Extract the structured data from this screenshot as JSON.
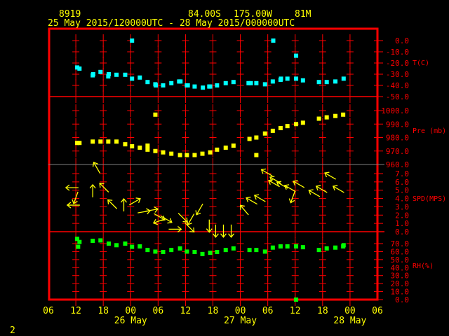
{
  "header": {
    "station": "8919",
    "latitude": "84.00S",
    "longitude": "175.00W",
    "elevation": "81M",
    "period": "25 May 2015/120000UTC - 28 May 2015/000000UTC"
  },
  "footer": {
    "page": "2"
  },
  "colors": {
    "frame": "#ff0000",
    "text": "#ffff00",
    "temperature": "#00ffff",
    "pressure": "#ffff00",
    "wind": "#ffff00",
    "humidity": "#00ff00",
    "divider_gray": "#808080"
  },
  "chart_data": {
    "type": "scatter",
    "x_unit": "hours since 25 May 2015 06 UTC",
    "xlim": [
      0,
      72
    ],
    "x_tick_labels": [
      "06",
      "12",
      "18",
      "00",
      "06",
      "12",
      "18",
      "00",
      "06",
      "12",
      "18",
      "00",
      "06"
    ],
    "date_labels": [
      {
        "hour": 18,
        "label": "26 May"
      },
      {
        "hour": 42,
        "label": "27 May"
      },
      {
        "hour": 66,
        "label": "28 May"
      }
    ],
    "panels": [
      {
        "id": "temperature",
        "ylabel": "T(C)",
        "ylim": [
          -50,
          0
        ],
        "tick_labels": [
          "0.0",
          "-10.0",
          "-20.0",
          "-30.0",
          "-40.0",
          "-50.0"
        ],
        "points": [
          [
            6.3,
            -24
          ],
          [
            6.8,
            -25
          ],
          [
            9.7,
            -31
          ],
          [
            9.8,
            -30
          ],
          [
            11.4,
            -28
          ],
          [
            13.1,
            -32
          ],
          [
            13.2,
            -30
          ],
          [
            14.9,
            -30.5
          ],
          [
            16.8,
            -30.5
          ],
          [
            18.3,
            -34
          ],
          [
            20,
            -33
          ],
          [
            21.7,
            -37
          ],
          [
            23.4,
            -39
          ],
          [
            23.5,
            -40
          ],
          [
            25.1,
            -40
          ],
          [
            26.9,
            -38
          ],
          [
            28.6,
            -36.5
          ],
          [
            28.9,
            -36.5
          ],
          [
            30.3,
            -40
          ],
          [
            30.5,
            -40
          ],
          [
            32,
            -41
          ],
          [
            33.8,
            -42
          ],
          [
            35.2,
            -41
          ],
          [
            35.4,
            -41
          ],
          [
            36.9,
            -40
          ],
          [
            38.8,
            -38
          ],
          [
            40.5,
            -37
          ],
          [
            43.8,
            -38
          ],
          [
            44.3,
            -38
          ],
          [
            45.5,
            -38
          ],
          [
            47.4,
            -39
          ],
          [
            49.1,
            -36.5
          ],
          [
            50.8,
            -35
          ],
          [
            50.9,
            -34
          ],
          [
            52.3,
            -34
          ],
          [
            54.2,
            -34
          ],
          [
            55.7,
            -35.5
          ],
          [
            59.2,
            -37
          ],
          [
            60.9,
            -37
          ],
          [
            62.8,
            -36.5
          ],
          [
            64.6,
            -34
          ],
          [
            18.3,
            0
          ],
          [
            49.2,
            0
          ],
          [
            54.2,
            -13.5
          ]
        ]
      },
      {
        "id": "pressure",
        "ylabel": "Pre (mb)",
        "ylim": [
          960,
          1000
        ],
        "tick_labels": [
          "1000.0",
          "990.0",
          "980.0",
          "970.0",
          "960.0"
        ],
        "points": [
          [
            6.3,
            976
          ],
          [
            6.8,
            976
          ],
          [
            9.7,
            977
          ],
          [
            11.4,
            977
          ],
          [
            13.1,
            977
          ],
          [
            14.9,
            977
          ],
          [
            16.8,
            975
          ],
          [
            18.3,
            973.5
          ],
          [
            20,
            972.5
          ],
          [
            21.7,
            974
          ],
          [
            21.7,
            971
          ],
          [
            23.4,
            970
          ],
          [
            25.1,
            969
          ],
          [
            26.9,
            968
          ],
          [
            28.8,
            967
          ],
          [
            30.3,
            967
          ],
          [
            32,
            967
          ],
          [
            33.7,
            968
          ],
          [
            35.4,
            969
          ],
          [
            36.9,
            971
          ],
          [
            38.8,
            972.5
          ],
          [
            40.5,
            974
          ],
          [
            44,
            979
          ],
          [
            45.5,
            980
          ],
          [
            47.4,
            983
          ],
          [
            49.1,
            985
          ],
          [
            50.8,
            987
          ],
          [
            52.3,
            988.5
          ],
          [
            54.2,
            990
          ],
          [
            55.7,
            991
          ],
          [
            59.2,
            994
          ],
          [
            60.9,
            995
          ],
          [
            62.8,
            996
          ],
          [
            64.5,
            997
          ],
          [
            23.4,
            997
          ],
          [
            45.5,
            967
          ]
        ]
      },
      {
        "id": "wind",
        "ylabel": "SPD(MPS)",
        "ylim": [
          0,
          7
        ],
        "tick_labels": [
          "7.0",
          "6.0",
          "5.0",
          "4.0",
          "3.0",
          "2.0",
          "1.0",
          "0.0"
        ],
        "direction_unit": "arrow heading, degrees clockwise from up",
        "points": [
          [
            10.6,
            7.7,
            330
          ],
          [
            5.2,
            5.3,
            270
          ],
          [
            6.0,
            4.1,
            200
          ],
          [
            5.5,
            3.2,
            270
          ],
          [
            9.7,
            4.9,
            0
          ],
          [
            12.2,
            5.3,
            315
          ],
          [
            14,
            3.3,
            315
          ],
          [
            16.5,
            3.2,
            0
          ],
          [
            18.9,
            3.6,
            60
          ],
          [
            20.9,
            2.4,
            80
          ],
          [
            22.6,
            2.6,
            80
          ],
          [
            24.3,
            1.8,
            120
          ],
          [
            25.8,
            1.5,
            120
          ],
          [
            24.3,
            1.3,
            250
          ],
          [
            29.4,
            1.7,
            135
          ],
          [
            31.2,
            1.5,
            210
          ],
          [
            30.9,
            0.5,
            135
          ],
          [
            27.7,
            0.3,
            90
          ],
          [
            33.1,
            2.7,
            210
          ],
          [
            35.2,
            0.7,
            180
          ],
          [
            36.6,
            0.1,
            180
          ],
          [
            38.3,
            0.1,
            180
          ],
          [
            40,
            0.1,
            180
          ],
          [
            47.8,
            7.1,
            300
          ],
          [
            49.7,
            6.2,
            300
          ],
          [
            49.4,
            5.8,
            300
          ],
          [
            51.2,
            5.6,
            300
          ],
          [
            52.9,
            5.2,
            300
          ],
          [
            53.5,
            4.2,
            200
          ],
          [
            54.8,
            5.7,
            300
          ],
          [
            61.7,
            6.7,
            300
          ],
          [
            63.5,
            5.1,
            300
          ],
          [
            59.8,
            5.1,
            300
          ],
          [
            58.2,
            4.6,
            300
          ],
          [
            44.5,
            3.7,
            300
          ],
          [
            46.3,
            4.0,
            300
          ],
          [
            42.9,
            2.6,
            320
          ]
        ]
      },
      {
        "id": "humidity",
        "ylabel": "RH(%)",
        "ylim": [
          0,
          70
        ],
        "tick_labels": [
          "70.0",
          "60.0",
          "50.0",
          "40.0",
          "30.0",
          "20.0",
          "10.0",
          "0.0"
        ],
        "points": [
          [
            6.3,
            76
          ],
          [
            6.5,
            66
          ],
          [
            6.8,
            72
          ],
          [
            9.7,
            73.5
          ],
          [
            11.4,
            74
          ],
          [
            13.2,
            70
          ],
          [
            14.9,
            68
          ],
          [
            16.8,
            70
          ],
          [
            18.3,
            66
          ],
          [
            20,
            66.5
          ],
          [
            21.7,
            62
          ],
          [
            23.4,
            60
          ],
          [
            25.1,
            59.5
          ],
          [
            26.9,
            62
          ],
          [
            28.8,
            64
          ],
          [
            30.3,
            60
          ],
          [
            32,
            59.5
          ],
          [
            33.7,
            57
          ],
          [
            35.4,
            58.5
          ],
          [
            36.9,
            59.5
          ],
          [
            38.8,
            62
          ],
          [
            40.5,
            64
          ],
          [
            44,
            62
          ],
          [
            45.5,
            62
          ],
          [
            47.4,
            60
          ],
          [
            49.1,
            65
          ],
          [
            50.8,
            66.5
          ],
          [
            52.3,
            66.5
          ],
          [
            54.2,
            66.5
          ],
          [
            55.7,
            65.5
          ],
          [
            59.2,
            62
          ],
          [
            60.9,
            64
          ],
          [
            62.8,
            65
          ],
          [
            64.5,
            66.5
          ],
          [
            64.6,
            68
          ],
          [
            54.2,
            0
          ]
        ]
      }
    ]
  }
}
